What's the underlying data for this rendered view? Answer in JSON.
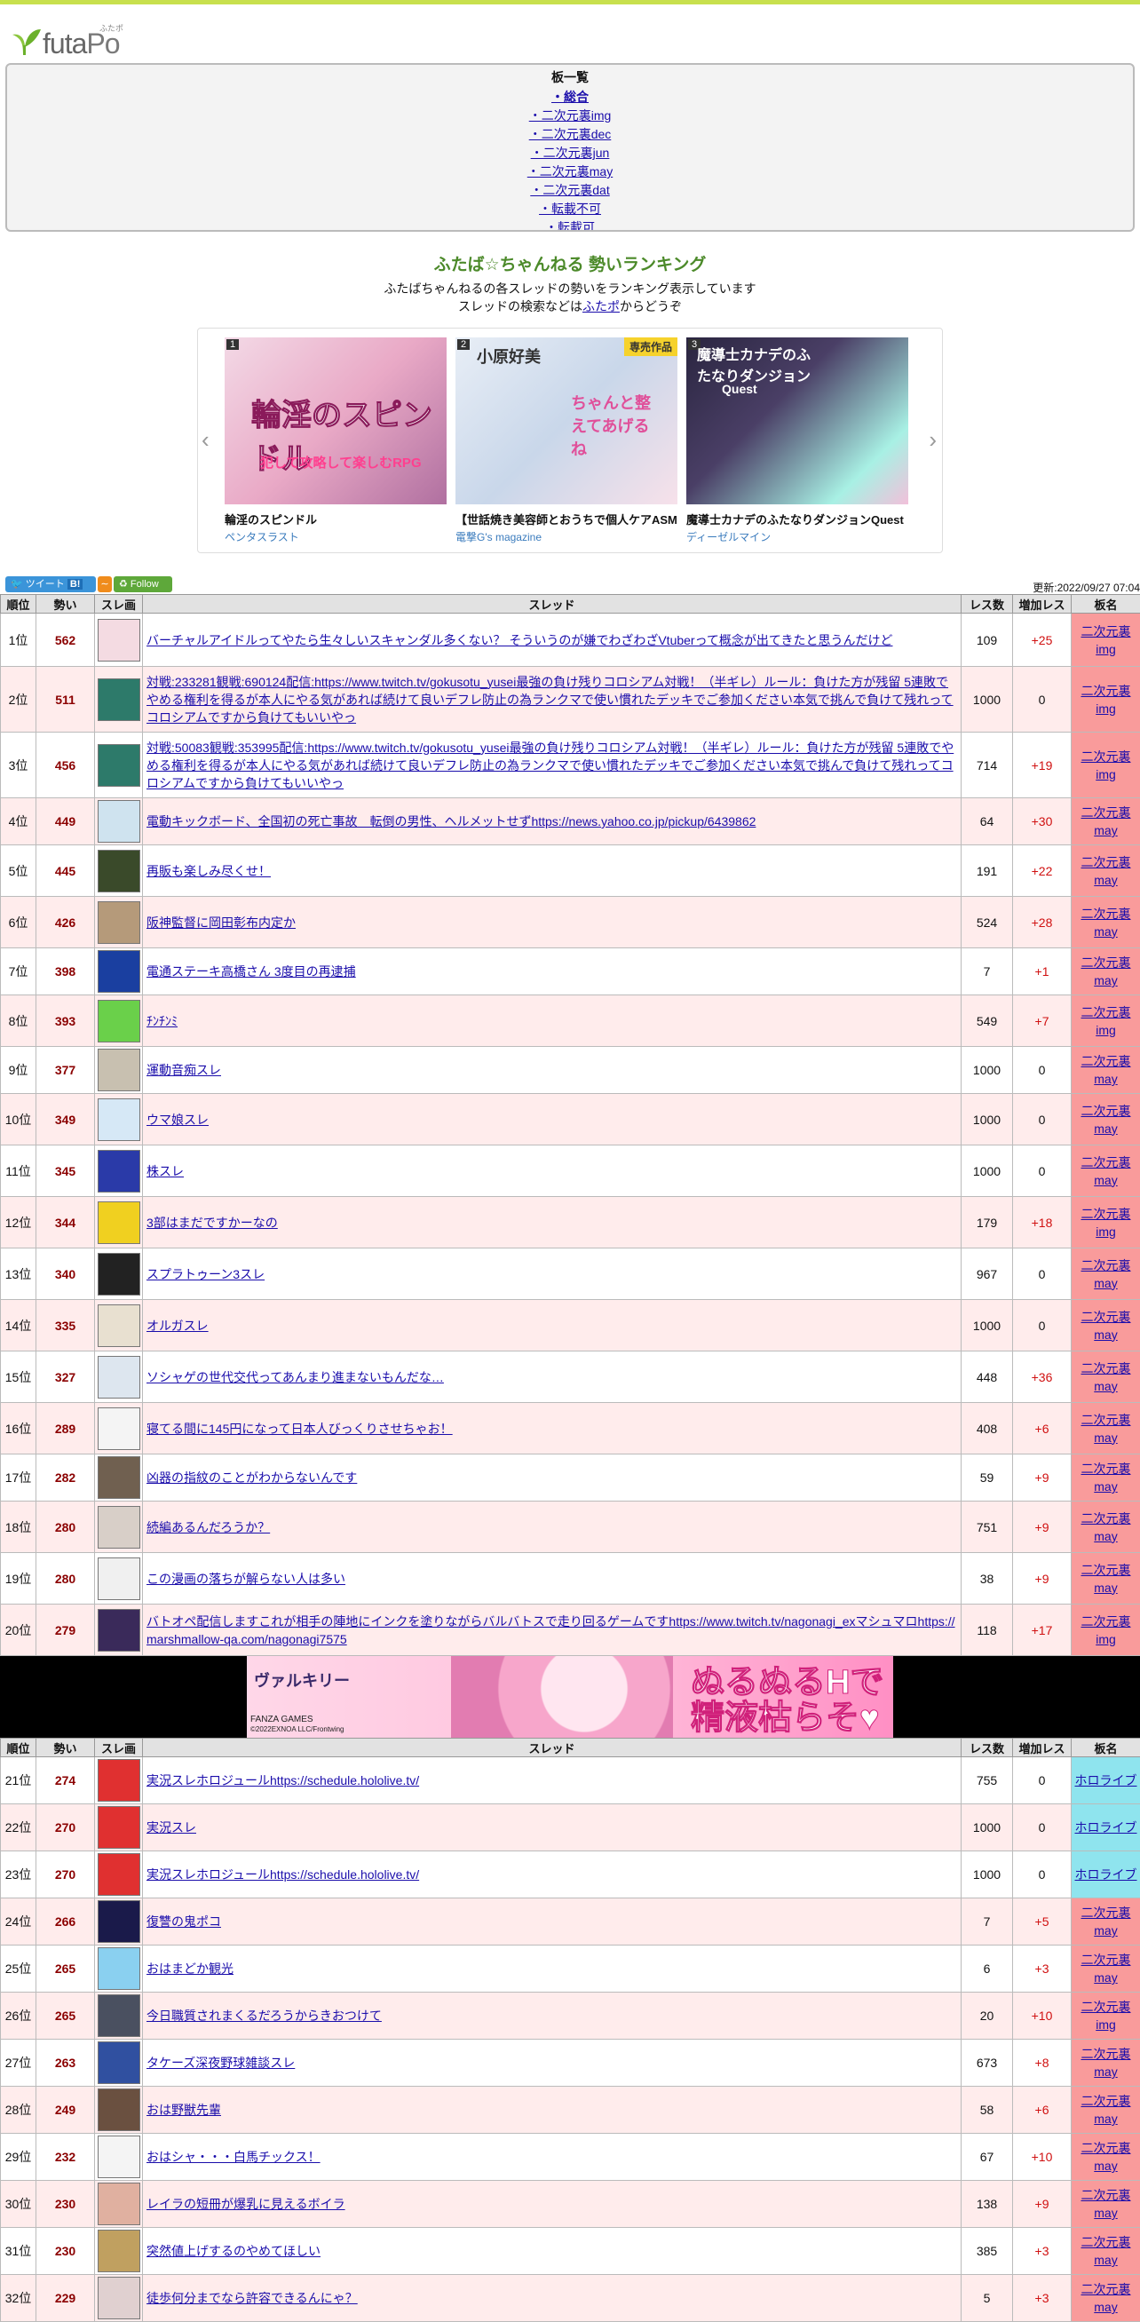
{
  "logo": {
    "text_a": "futa",
    "text_b": "Po",
    "sub": "ふたポ"
  },
  "boards": {
    "heading": "板一覧",
    "items": [
      "・総合",
      "・二次元裏img",
      "・二次元裏dec",
      "・二次元裏jun",
      "・二次元裏may",
      "・二次元裏dat",
      "・転載不可",
      "・転載可",
      "・…"
    ]
  },
  "intro": {
    "title": "ふたば☆ちゃんねる 勢いランキング",
    "line1": "ふたばちゃんねるの各スレッドの勢いをランキング表示しています",
    "line2_pre": "スレッドの検索などは",
    "line2_link": "ふたポ",
    "line2_post": "からどうぞ"
  },
  "carousel": [
    {
      "num": "1",
      "badge": "",
      "art": "輪淫のスピンドル",
      "sub": "犯して攻略して楽しむRPG",
      "title": "輪淫のスピンドル",
      "maker": "ペンタスラスト"
    },
    {
      "num": "2",
      "badge": "専売作品",
      "art": "小原好美",
      "sub": "ちゃんと整えてあげるね",
      "title": "【世話焼き美容師とおうちで個人ケアASM",
      "maker": "電撃G's magazine"
    },
    {
      "num": "3",
      "badge": "",
      "art": "魔導士カナデのふたなりダンジョン",
      "sub": "Quest",
      "title": "魔導士カナデのふたなりダンジョンQuest",
      "maker": "ディーゼルマイン"
    }
  ],
  "toolbar": {
    "tweet": "ツイート",
    "hatena": "B!",
    "follow": "Follow",
    "updated": "更新:2022/09/27 07:04"
  },
  "headers": [
    "順位",
    "勢い",
    "スレ画",
    "スレッド",
    "レス数",
    "増加レス",
    "板名"
  ],
  "rows1": [
    {
      "rank": "1位",
      "ikioi": "562",
      "title": "バーチャルアイドルってやたら生々しいスキャンダル多くない？ そういうのが嫌でわざわざVtuberって概念が出てきたと思うんだけど",
      "res": "109",
      "inc": "+25",
      "board": "二次元裏img"
    },
    {
      "rank": "2位",
      "ikioi": "511",
      "title": "対戦:233281観戦:690124配信:https://www.twitch.tv/gokusotu_yusei最強の負け残りコロシアム対戦！（半ギレ）ルール：負けた方が残留 5連敗でやめる権利を得るが本人にやる気があれば続けて良いデフレ防止の為ランクマで使い慣れたデッキでご参加ください本気で挑んで負けて残れってコロシアムですから負けてもいいやっ",
      "res": "1000",
      "inc": "0",
      "board": "二次元裏img"
    },
    {
      "rank": "3位",
      "ikioi": "456",
      "title": "対戦:50083観戦:353995配信:https://www.twitch.tv/gokusotu_yusei最強の負け残りコロシアム対戦！（半ギレ）ルール：負けた方が残留 5連敗でやめる権利を得るが本人にやる気があれば続けて良いデフレ防止の為ランクマで使い慣れたデッキでご参加ください本気で挑んで負けて残れってコロシアムですから負けてもいいやっ",
      "res": "714",
      "inc": "+19",
      "board": "二次元裏img"
    },
    {
      "rank": "4位",
      "ikioi": "449",
      "title": "電動キックボード、全国初の死亡事故　転倒の男性、ヘルメットせずhttps://news.yahoo.co.jp/pickup/6439862",
      "res": "64",
      "inc": "+30",
      "board": "二次元裏may"
    },
    {
      "rank": "5位",
      "ikioi": "445",
      "title": "再販も楽しみ尽くせ！",
      "res": "191",
      "inc": "+22",
      "board": "二次元裏may"
    },
    {
      "rank": "6位",
      "ikioi": "426",
      "title": "阪神監督に岡田彰布内定か",
      "res": "524",
      "inc": "+28",
      "board": "二次元裏may"
    },
    {
      "rank": "7位",
      "ikioi": "398",
      "title": "電通ステーキ高橋さん 3度目の再逮捕",
      "res": "7",
      "inc": "+1",
      "board": "二次元裏may"
    },
    {
      "rank": "8位",
      "ikioi": "393",
      "title": "ﾁﾝﾁﾝﾐ",
      "res": "549",
      "inc": "+7",
      "board": "二次元裏img"
    },
    {
      "rank": "9位",
      "ikioi": "377",
      "title": "運動音痴スレ",
      "res": "1000",
      "inc": "0",
      "board": "二次元裏may"
    },
    {
      "rank": "10位",
      "ikioi": "349",
      "title": "ウマ娘スレ",
      "res": "1000",
      "inc": "0",
      "board": "二次元裏may"
    },
    {
      "rank": "11位",
      "ikioi": "345",
      "title": "株スレ",
      "res": "1000",
      "inc": "0",
      "board": "二次元裏may"
    },
    {
      "rank": "12位",
      "ikioi": "344",
      "title": "3部はまだですかーなの",
      "res": "179",
      "inc": "+18",
      "board": "二次元裏img"
    },
    {
      "rank": "13位",
      "ikioi": "340",
      "title": "スプラトゥーン3スレ",
      "res": "967",
      "inc": "0",
      "board": "二次元裏may"
    },
    {
      "rank": "14位",
      "ikioi": "335",
      "title": "オルガスレ",
      "res": "1000",
      "inc": "0",
      "board": "二次元裏may"
    },
    {
      "rank": "15位",
      "ikioi": "327",
      "title": "ソシャゲの世代交代ってあんまり進まないもんだな…",
      "res": "448",
      "inc": "+36",
      "board": "二次元裏may"
    },
    {
      "rank": "16位",
      "ikioi": "289",
      "title": "寝てる間に145円になって日本人びっくりさせちゃお！",
      "res": "408",
      "inc": "+6",
      "board": "二次元裏may"
    },
    {
      "rank": "17位",
      "ikioi": "282",
      "title": "凶器の指紋のことがわからないんです",
      "res": "59",
      "inc": "+9",
      "board": "二次元裏may"
    },
    {
      "rank": "18位",
      "ikioi": "280",
      "title": "続編あるんだろうか？",
      "res": "751",
      "inc": "+9",
      "board": "二次元裏may"
    },
    {
      "rank": "19位",
      "ikioi": "280",
      "title": "この漫画の落ちが解らない人は多い",
      "res": "38",
      "inc": "+9",
      "board": "二次元裏may"
    },
    {
      "rank": "20位",
      "ikioi": "279",
      "title": "バトオペ配信しますこれが相手の陣地にインクを塗りながらバルバトスで走り回るゲームですhttps://www.twitch.tv/nagonagi_exマシュマロhttps://marshmallow-qa.com/nagonagi7575",
      "res": "118",
      "inc": "+17",
      "board": "二次元裏img"
    }
  ],
  "banner": {
    "logo": "ヴァルキリー",
    "brand": "FANZA GAMES",
    "copy": "©2022EXNOA LLC/Frontwing",
    "catch1": "ぬるぬるHで",
    "catch2": "精液枯らそ♥"
  },
  "rows2": [
    {
      "rank": "21位",
      "ikioi": "274",
      "title": "実況スレホロジュールhttps://schedule.hololive.tv/",
      "res": "755",
      "inc": "0",
      "board": "ホロライブ"
    },
    {
      "rank": "22位",
      "ikioi": "270",
      "title": "実況スレ",
      "res": "1000",
      "inc": "0",
      "board": "ホロライブ"
    },
    {
      "rank": "23位",
      "ikioi": "270",
      "title": "実況スレホロジュールhttps://schedule.hololive.tv/",
      "res": "1000",
      "inc": "0",
      "board": "ホロライブ"
    },
    {
      "rank": "24位",
      "ikioi": "266",
      "title": "復讐の鬼ポコ",
      "res": "7",
      "inc": "+5",
      "board": "二次元裏may"
    },
    {
      "rank": "25位",
      "ikioi": "265",
      "title": "おはまどか観光",
      "res": "6",
      "inc": "+3",
      "board": "二次元裏may"
    },
    {
      "rank": "26位",
      "ikioi": "265",
      "title": "今日職質されまくるだろうからきおつけて",
      "res": "20",
      "inc": "+10",
      "board": "二次元裏img"
    },
    {
      "rank": "27位",
      "ikioi": "263",
      "title": "タケーズ深夜野球雑談スレ",
      "res": "673",
      "inc": "+8",
      "board": "二次元裏may"
    },
    {
      "rank": "28位",
      "ikioi": "249",
      "title": "おは野獣先輩",
      "res": "58",
      "inc": "+6",
      "board": "二次元裏may"
    },
    {
      "rank": "29位",
      "ikioi": "232",
      "title": "おはシャ・・・白馬チックス！",
      "res": "67",
      "inc": "+10",
      "board": "二次元裏may"
    },
    {
      "rank": "30位",
      "ikioi": "230",
      "title": "レイラの短冊が爆乳に見えるボイラ",
      "res": "138",
      "inc": "+9",
      "board": "二次元裏may"
    },
    {
      "rank": "31位",
      "ikioi": "230",
      "title": "突然値上げするのやめてほしい",
      "res": "385",
      "inc": "+3",
      "board": "二次元裏may"
    },
    {
      "rank": "32位",
      "ikioi": "229",
      "title": "徒歩何分までなら許容できるんにゃ？",
      "res": "5",
      "inc": "+3",
      "board": "二次元裏may"
    }
  ],
  "colors": {
    "accent_top": "#c8e04e",
    "board_cell": "#f99b9b",
    "holo_cell": "#8fe4ee",
    "even_row": "#ffecec",
    "ikioi_text": "#8b0000",
    "increase_text": "#d01010"
  }
}
